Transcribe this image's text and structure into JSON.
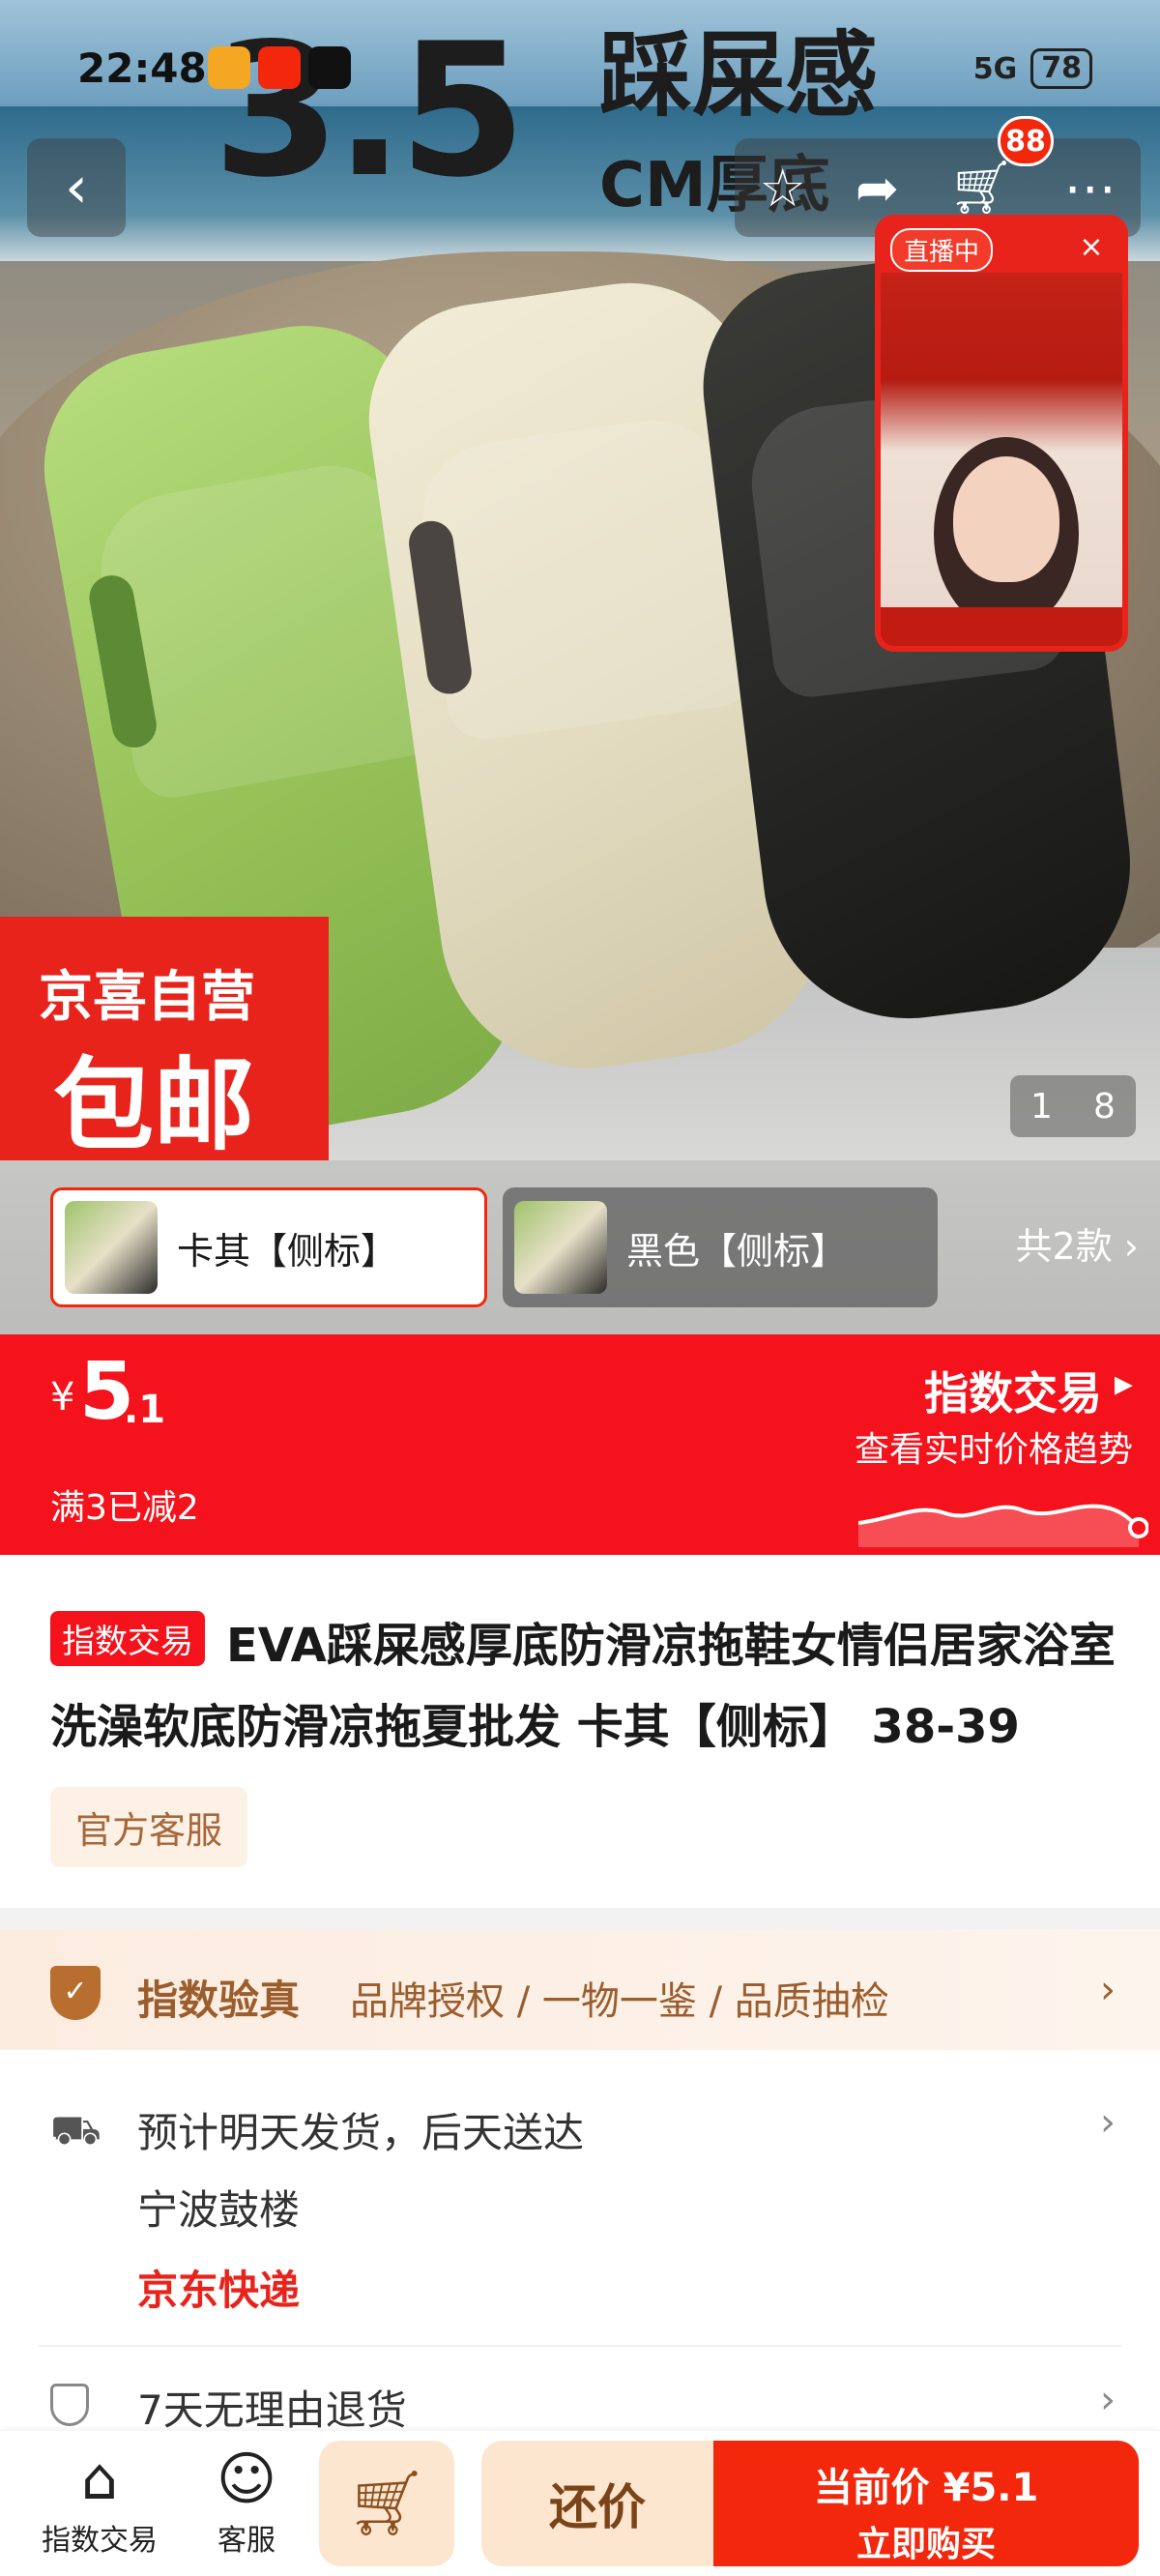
{
  "status_bar": {
    "time": "22:48",
    "network": "5G",
    "battery": "78"
  },
  "hero": {
    "headline_number": "3.5",
    "headline_text": "踩屎感",
    "headline_sub": "CM厚底",
    "cart_badge": "88",
    "live": {
      "badge": "直播中",
      "close": "×"
    },
    "shop_badge_line1": "京喜自营",
    "shop_badge_line2": "包邮",
    "pager_current": "1",
    "pager_total": "8"
  },
  "variants": {
    "items": [
      {
        "label": "卡其【侧标】",
        "selected": true
      },
      {
        "label": "黑色【侧标】",
        "selected": false
      }
    ],
    "count": "共2款"
  },
  "price": {
    "currency": "¥",
    "integer": "5",
    "decimal": ".1",
    "promo": "满3已减2",
    "index_trade": "指数交易",
    "trend_link": "查看实时价格趋势"
  },
  "product": {
    "tag": "指数交易",
    "title": "EVA踩屎感厚底防滑凉拖鞋女情侣居家浴室洗澡软底防滑凉拖夏批发 卡其【侧标】 38-39",
    "service": "官方客服"
  },
  "verify": {
    "name": "指数验真",
    "desc": "品牌授权 / 一物一鉴 / 品质抽检"
  },
  "shipping": {
    "eta": "预计明天发货，后天送达",
    "origin": "宁波鼓楼",
    "carrier": "京东快递"
  },
  "returns": {
    "text": "7天无理由退货"
  },
  "bottom_bar": {
    "index_label": "指数交易",
    "service_label": "客服",
    "bargain": "还价",
    "current_price": "当前价 ¥5.1",
    "buy_now": "立即购买"
  },
  "colors": {
    "brand_red": "#f4131d",
    "accent_gold": "#9b5d2c"
  }
}
